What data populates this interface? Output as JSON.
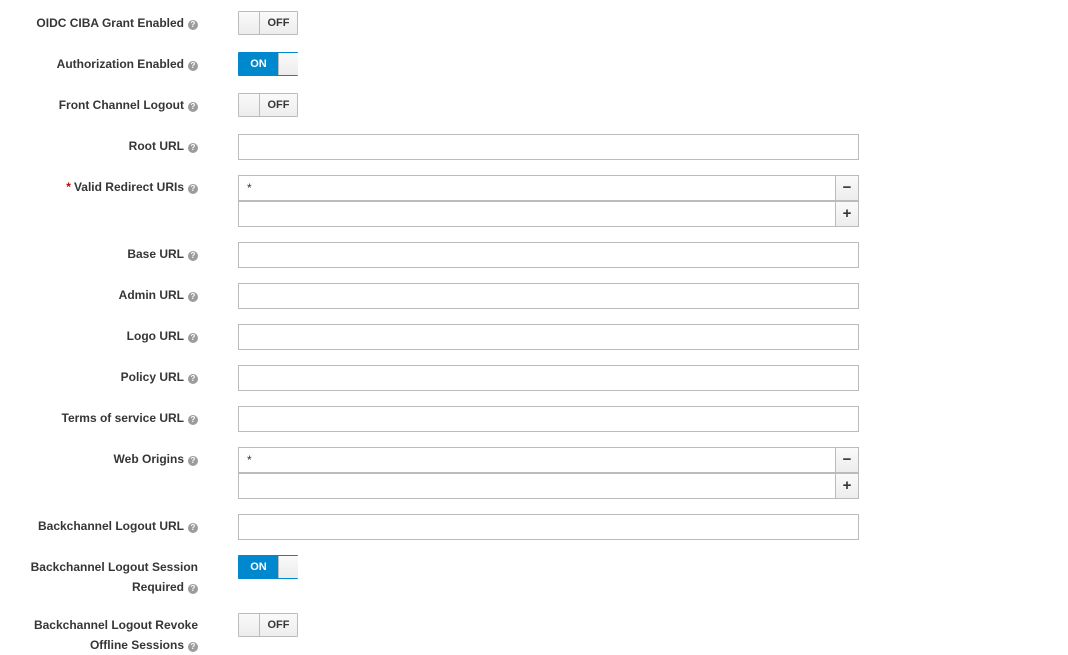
{
  "fields": {
    "ciba": {
      "label": "OIDC CIBA Grant Enabled",
      "state": "OFF"
    },
    "authorization": {
      "label": "Authorization Enabled",
      "state": "ON"
    },
    "front_channel": {
      "label": "Front Channel Logout",
      "state": "OFF"
    },
    "root_url": {
      "label": "Root URL",
      "value": ""
    },
    "redirect_uris": {
      "required_mark": "*",
      "label": "Valid Redirect URIs",
      "values": [
        "*",
        ""
      ]
    },
    "base_url": {
      "label": "Base URL",
      "value": ""
    },
    "admin_url": {
      "label": "Admin URL",
      "value": ""
    },
    "logo_url": {
      "label": "Logo URL",
      "value": ""
    },
    "policy_url": {
      "label": "Policy URL",
      "value": ""
    },
    "tos_url": {
      "label": "Terms of service URL",
      "value": ""
    },
    "web_origins": {
      "label": "Web Origins",
      "values": [
        "*",
        ""
      ]
    },
    "backchannel_url": {
      "label": "Backchannel Logout URL",
      "value": ""
    },
    "backchannel_session": {
      "label_line1": "Backchannel Logout Session",
      "label_line2": "Required",
      "state": "ON"
    },
    "backchannel_revoke": {
      "label_line1": "Backchannel Logout Revoke",
      "label_line2": "Offline Sessions",
      "state": "OFF"
    }
  },
  "icons": {
    "help": "question-circle-icon",
    "remove": "minus-icon",
    "add": "plus-icon"
  },
  "glyphs": {
    "help": "?",
    "remove": "−",
    "add": "+"
  },
  "colors": {
    "accent": "#0088ce",
    "required": "#cc0000",
    "label": "#363636"
  }
}
